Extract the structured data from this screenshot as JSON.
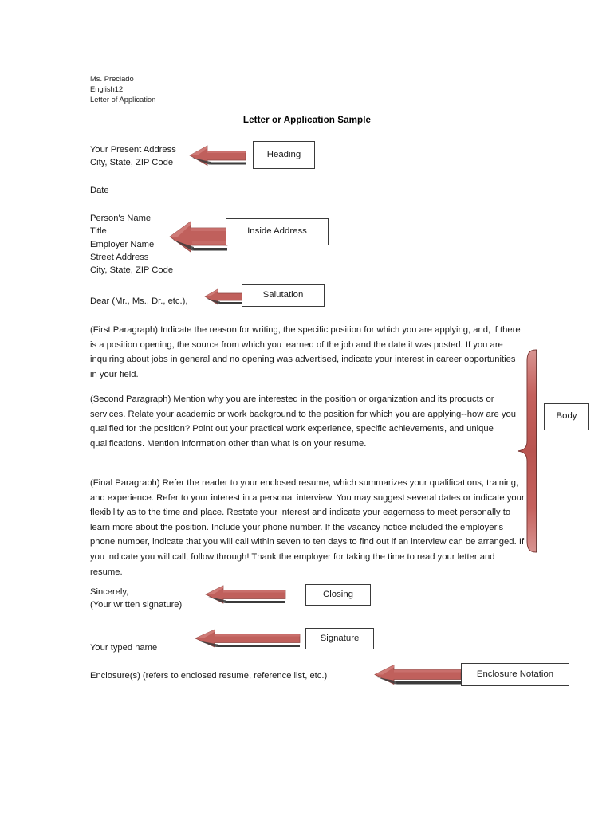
{
  "document": {
    "course_info": "Ms. Preciado\nEnglish12\nLetter of Application",
    "title": "Letter or Application Sample",
    "heading_block": "Your Present Address\nCity, State, ZIP Code",
    "date_block": "Date",
    "inside_address_block": "Person's Name\nTitle\nEmployer Name\nStreet Address\nCity, State, ZIP Code",
    "salutation_block": "Dear (Mr., Ms., Dr., etc.),",
    "paragraph_first": "(First Paragraph) Indicate the reason for writing, the specific position for which you are applying, and, if there is a position opening, the source from which you learned of the job and the date it was posted. If you are inquiring about jobs in general and no opening was advertised, indicate your interest in career opportunities in your field.",
    "paragraph_second": "(Second Paragraph) Mention why you are interested in the position or organization and its products or services. Relate your academic or work background to the position for which you are applying--how are you qualified for the position? Point out your practical work experience, specific achievements, and unique qualifications. Mention information other than what is on your resume.",
    "paragraph_final": "(Final Paragraph) Refer the reader to your enclosed resume, which summarizes your qualifications, training, and experience. Refer to your interest in a personal interview. You may suggest several dates or indicate your flexibility as to the time and place. Restate your interest and indicate your eagerness to meet personally to learn more about the position. Include your phone number. If the vacancy notice included the employer's phone number, indicate that you will call within seven to ten days to find out if an interview can be arranged. If you indicate you will call, follow through! Thank the employer for taking the time to read your letter and resume.",
    "closing_block": "Sincerely,\n(Your written signature)",
    "typed_name_block": "Your typed name",
    "enclosure_block": "Enclosure(s) (refers to enclosed resume, reference list, etc.)"
  },
  "callouts": {
    "heading": "Heading",
    "inside_address": "Inside Address",
    "salutation": "Salutation",
    "body": "Body",
    "closing": "Closing",
    "signature": "Signature",
    "enclosure_notation": "Enclosure Notation"
  },
  "colors": {
    "arrow_fill": "#c0605c",
    "arrow_fill_light": "#cf7a76",
    "arrow_shadow": "#3b3b3b",
    "arrow_outline": "#8d4440",
    "box_border": "#3a3a3a",
    "page_background": "#ffffff",
    "text": "#1a1a1a"
  }
}
